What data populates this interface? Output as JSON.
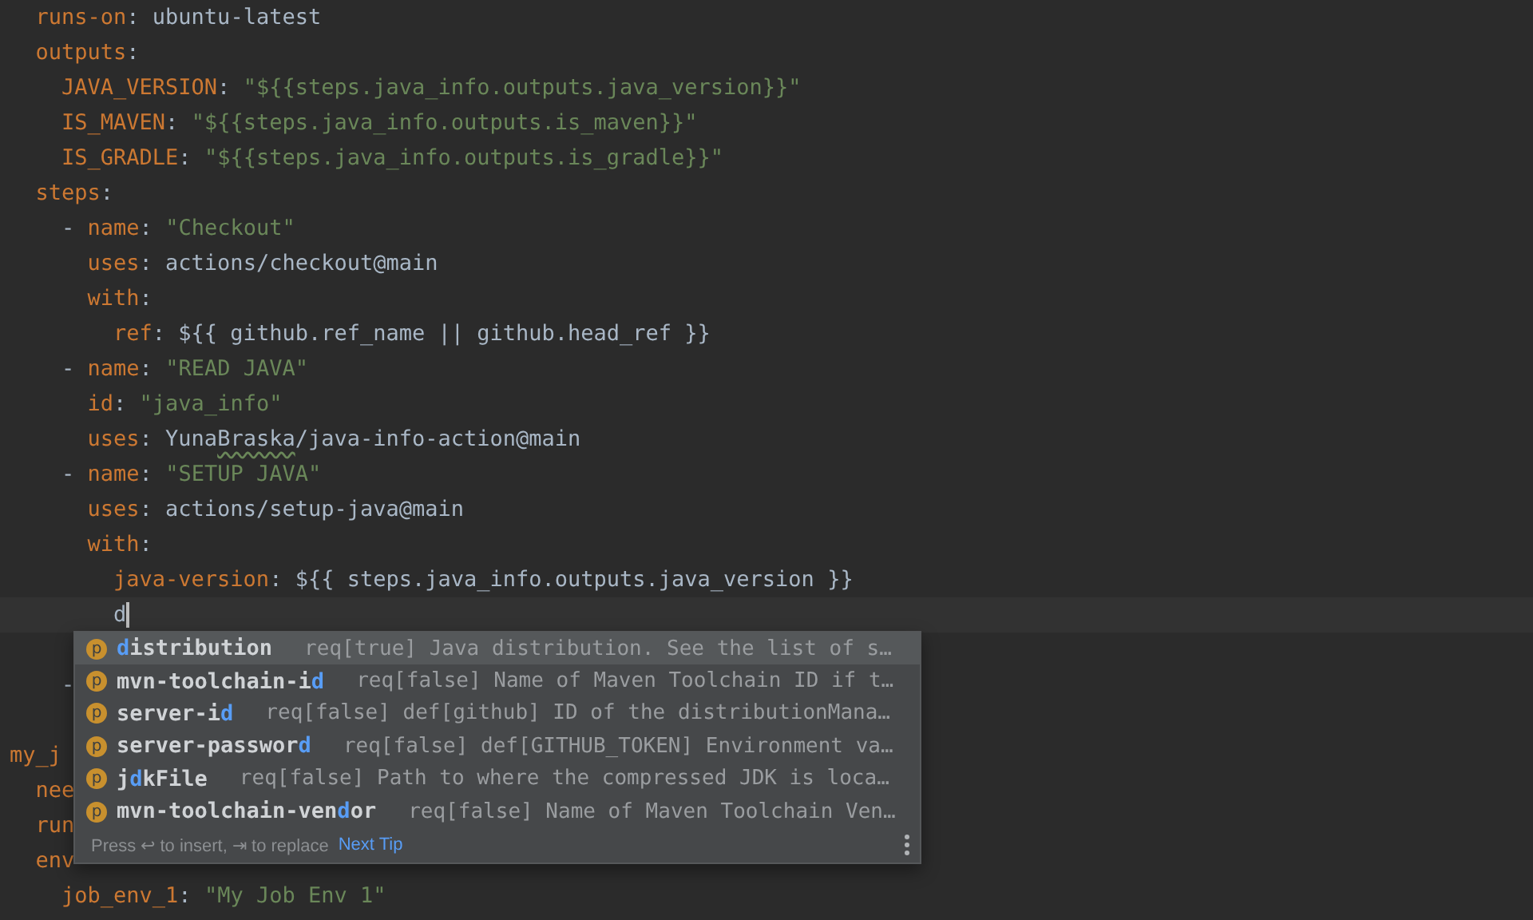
{
  "editor": {
    "lines": [
      {
        "tokens": [
          {
            "kind": "key",
            "text": "  runs-on"
          },
          {
            "kind": "punct",
            "text": ": "
          },
          {
            "kind": "plain",
            "text": "ubuntu-latest"
          }
        ]
      },
      {
        "tokens": [
          {
            "kind": "key",
            "text": "  outputs"
          },
          {
            "kind": "punct",
            "text": ":"
          }
        ]
      },
      {
        "tokens": [
          {
            "kind": "key",
            "text": "    JAVA_VERSION"
          },
          {
            "kind": "punct",
            "text": ": "
          },
          {
            "kind": "string",
            "text": "\"${{steps.java_info.outputs.java_version}}\""
          }
        ]
      },
      {
        "tokens": [
          {
            "kind": "key",
            "text": "    IS_MAVEN"
          },
          {
            "kind": "punct",
            "text": ": "
          },
          {
            "kind": "string",
            "text": "\"${{steps.java_info.outputs.is_maven}}\""
          }
        ]
      },
      {
        "tokens": [
          {
            "kind": "key",
            "text": "    IS_GRADLE"
          },
          {
            "kind": "punct",
            "text": ": "
          },
          {
            "kind": "string",
            "text": "\"${{steps.java_info.outputs.is_gradle}}\""
          }
        ]
      },
      {
        "tokens": [
          {
            "kind": "key",
            "text": "  steps"
          },
          {
            "kind": "punct",
            "text": ":"
          }
        ]
      },
      {
        "tokens": [
          {
            "kind": "punct",
            "text": "    - "
          },
          {
            "kind": "key",
            "text": "name"
          },
          {
            "kind": "punct",
            "text": ": "
          },
          {
            "kind": "string",
            "text": "\"Checkout\""
          }
        ]
      },
      {
        "tokens": [
          {
            "kind": "key",
            "text": "      uses"
          },
          {
            "kind": "punct",
            "text": ": "
          },
          {
            "kind": "plain",
            "text": "actions/checkout@main"
          }
        ]
      },
      {
        "tokens": [
          {
            "kind": "key",
            "text": "      with"
          },
          {
            "kind": "punct",
            "text": ":"
          }
        ]
      },
      {
        "tokens": [
          {
            "kind": "key",
            "text": "        ref"
          },
          {
            "kind": "punct",
            "text": ": "
          },
          {
            "kind": "plain",
            "text": "${{ github.ref_name || github.head_ref }}"
          }
        ]
      },
      {
        "tokens": [
          {
            "kind": "punct",
            "text": "    - "
          },
          {
            "kind": "key",
            "text": "name"
          },
          {
            "kind": "punct",
            "text": ": "
          },
          {
            "kind": "string",
            "text": "\"READ JAVA\""
          }
        ]
      },
      {
        "tokens": [
          {
            "kind": "key",
            "text": "      id"
          },
          {
            "kind": "punct",
            "text": ": "
          },
          {
            "kind": "string",
            "text": "\"java_info\""
          }
        ]
      },
      {
        "tokens": [
          {
            "kind": "key",
            "text": "      uses"
          },
          {
            "kind": "punct",
            "text": ": "
          },
          {
            "kind": "plain",
            "text": "Yuna"
          },
          {
            "kind": "typo",
            "text": "Braska"
          },
          {
            "kind": "plain",
            "text": "/java-info-action@main"
          }
        ]
      },
      {
        "tokens": [
          {
            "kind": "punct",
            "text": "    - "
          },
          {
            "kind": "key",
            "text": "name"
          },
          {
            "kind": "punct",
            "text": ": "
          },
          {
            "kind": "string",
            "text": "\"SETUP JAVA\""
          }
        ]
      },
      {
        "tokens": [
          {
            "kind": "key",
            "text": "      uses"
          },
          {
            "kind": "punct",
            "text": ": "
          },
          {
            "kind": "plain",
            "text": "actions/setup-java@main"
          }
        ]
      },
      {
        "tokens": [
          {
            "kind": "key",
            "text": "      with"
          },
          {
            "kind": "punct",
            "text": ":"
          }
        ]
      },
      {
        "tokens": [
          {
            "kind": "key",
            "text": "        java-version"
          },
          {
            "kind": "punct",
            "text": ": "
          },
          {
            "kind": "plain",
            "text": "${{ steps.java_info.outputs.java_version }}"
          }
        ]
      },
      {
        "tokens": [
          {
            "kind": "plain",
            "text": "        d"
          },
          {
            "kind": "caret"
          }
        ]
      },
      {
        "kind": "after_blank",
        "tokens": [
          {
            "kind": "punct",
            "text": "    -"
          }
        ]
      },
      {
        "kind": "after_blank",
        "tokens": [
          {
            "kind": "key",
            "text": "my_j"
          }
        ]
      },
      {
        "tokens": [
          {
            "kind": "key",
            "text": "  nee"
          }
        ]
      },
      {
        "tokens": [
          {
            "kind": "key",
            "text": "  run"
          }
        ]
      },
      {
        "tokens": [
          {
            "kind": "key",
            "text": "  env"
          }
        ]
      },
      {
        "tokens": [
          {
            "kind": "key",
            "text": "    job_env_1"
          },
          {
            "kind": "punct",
            "text": ": "
          },
          {
            "kind": "string",
            "text": "\"My Job Env 1\""
          }
        ]
      }
    ]
  },
  "completion": {
    "items": [
      {
        "selected": true,
        "icon": "p",
        "match": "d",
        "after": "istribution",
        "detail": "req[true] Java distribution. See the list of s…"
      },
      {
        "selected": false,
        "icon": "p",
        "before": "mvn-toolchain-i",
        "match": "d",
        "detail": "req[false] Name of Maven Toolchain ID if t…"
      },
      {
        "selected": false,
        "icon": "p",
        "before": "server-i",
        "match": "d",
        "detail": "req[false] def[github] ID of the distributionMana…"
      },
      {
        "selected": false,
        "icon": "p",
        "before": "server-passwor",
        "match": "d",
        "detail": "req[false] def[GITHUB_TOKEN] Environment va…"
      },
      {
        "selected": false,
        "icon": "p",
        "before": "j",
        "match": "d",
        "after": "kFile",
        "detail": "req[false] Path to where the compressed JDK is loca…"
      },
      {
        "selected": false,
        "icon": "p",
        "before": "mvn-toolchain-ven",
        "match": "d",
        "after": "or",
        "detail": "req[false] Name of Maven Toolchain Ven…"
      }
    ],
    "hint": "Press ↩ to insert, ⇥ to replace",
    "hint_link": "Next Tip"
  }
}
